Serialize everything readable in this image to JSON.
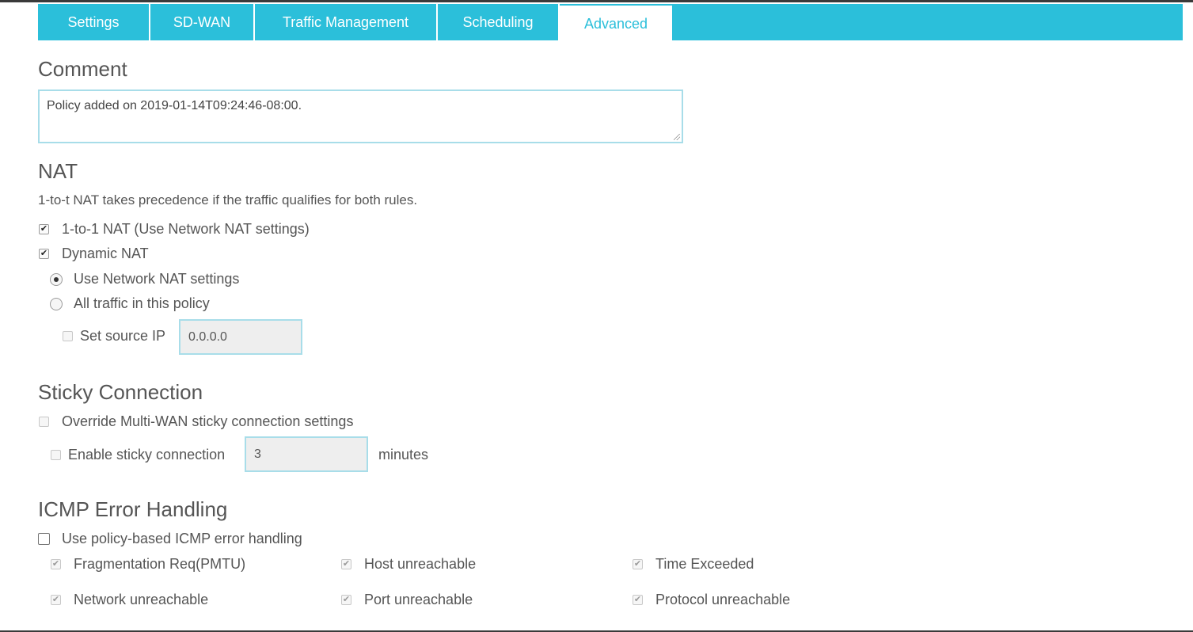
{
  "tabs": [
    {
      "label": "Settings",
      "active": false
    },
    {
      "label": "SD-WAN",
      "active": false
    },
    {
      "label": "Traffic Management",
      "active": false
    },
    {
      "label": "Scheduling",
      "active": false
    },
    {
      "label": "Advanced",
      "active": true
    }
  ],
  "comment": {
    "title": "Comment",
    "value": "Policy added on 2019-01-14T09:24:46-08:00."
  },
  "nat": {
    "title": "NAT",
    "note": "1-to-t NAT takes precedence if the traffic qualifies for both rules.",
    "one_to_one_label": "1-to-1 NAT (Use Network NAT settings)",
    "one_to_one_checked": true,
    "dynamic_label": "Dynamic NAT",
    "dynamic_checked": true,
    "radio_network_label": "Use Network NAT settings",
    "radio_all_label": "All traffic in this policy",
    "selected_radio": "network",
    "source_ip_label": "Set source IP",
    "source_ip_checked": false,
    "source_ip_value": "0.0.0.0"
  },
  "sticky": {
    "title": "Sticky Connection",
    "override_label": "Override Multi-WAN sticky connection settings",
    "override_checked": false,
    "enable_label": "Enable sticky connection",
    "enable_checked": false,
    "minutes_value": "3",
    "minutes_unit": "minutes"
  },
  "icmp": {
    "title": "ICMP Error Handling",
    "policy_label": "Use policy-based ICMP error handling",
    "policy_checked": false,
    "options": [
      {
        "label": "Fragmentation Req(PMTU)",
        "checked": true
      },
      {
        "label": "Host unreachable",
        "checked": true
      },
      {
        "label": "Time Exceeded",
        "checked": true
      },
      {
        "label": "Network unreachable",
        "checked": true
      },
      {
        "label": "Port unreachable",
        "checked": true
      },
      {
        "label": "Protocol unreachable",
        "checked": true
      }
    ]
  }
}
